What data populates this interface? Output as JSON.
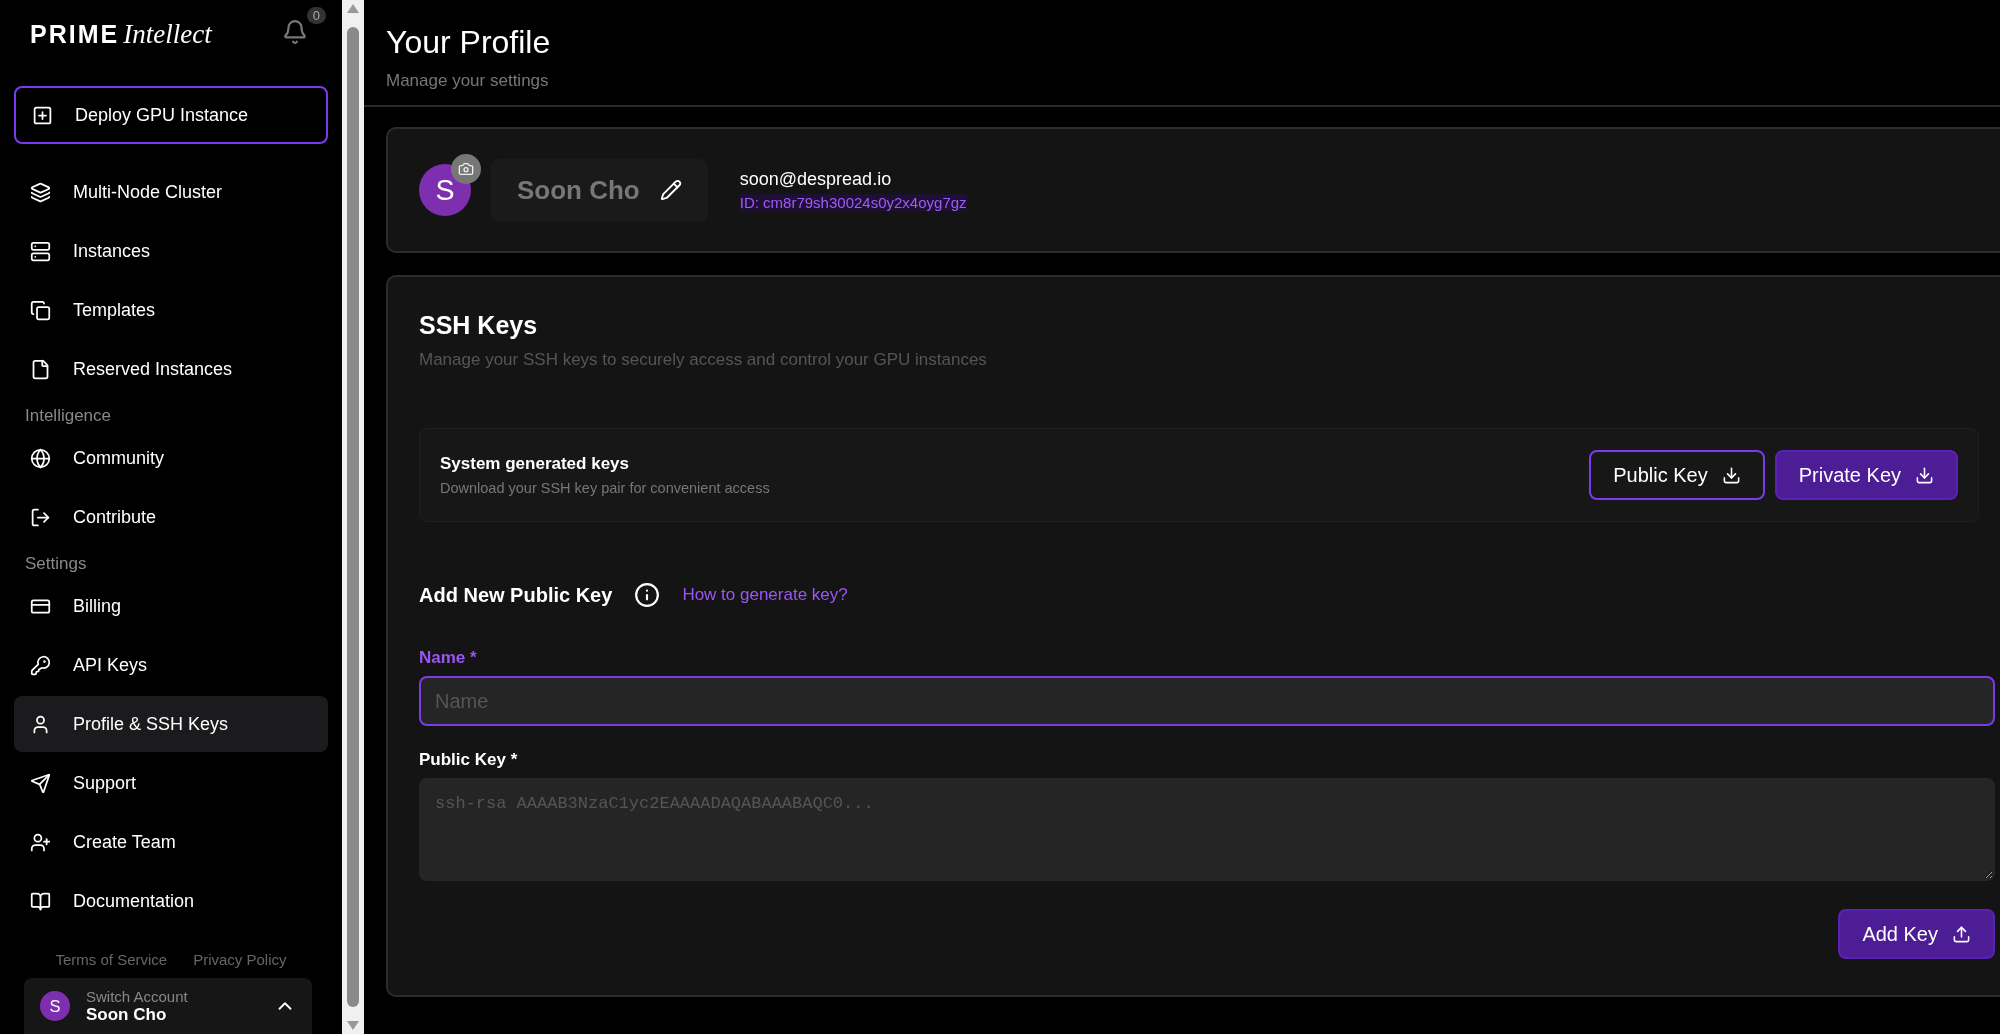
{
  "brand": {
    "wordmark": "PRIME",
    "script": "Intellect"
  },
  "notifications": {
    "count": "0"
  },
  "sidebar": {
    "items": [
      {
        "kind": "primary",
        "label": "Deploy GPU Instance",
        "selected": false
      },
      {
        "kind": "item",
        "label": "Multi-Node Cluster",
        "selected": false
      },
      {
        "kind": "item",
        "label": "Instances",
        "selected": false
      },
      {
        "kind": "item",
        "label": "Templates",
        "selected": false
      },
      {
        "kind": "item",
        "label": "Reserved Instances",
        "selected": false
      },
      {
        "kind": "section",
        "label": "Intelligence"
      },
      {
        "kind": "item",
        "label": "Community",
        "selected": false
      },
      {
        "kind": "item",
        "label": "Contribute",
        "selected": false
      },
      {
        "kind": "section",
        "label": "Settings"
      },
      {
        "kind": "item",
        "label": "Billing",
        "selected": false
      },
      {
        "kind": "item",
        "label": "API Keys",
        "selected": false
      },
      {
        "kind": "item",
        "label": "Profile & SSH Keys",
        "selected": true
      },
      {
        "kind": "item",
        "label": "Support",
        "selected": false
      },
      {
        "kind": "item",
        "label": "Create Team",
        "selected": false
      },
      {
        "kind": "item",
        "label": "Documentation",
        "selected": false
      }
    ],
    "footer_links": [
      "Terms of Service",
      "Privacy Policy"
    ],
    "account": {
      "initial": "S",
      "caption": "Switch Account",
      "name": "Soon Cho",
      "expanded": true
    }
  },
  "header": {
    "title": "Your Profile",
    "subtitle": "Manage your settings"
  },
  "profile": {
    "initial": "S",
    "name": "Soon Cho",
    "email": "soon@despread.io",
    "id": "ID: cm8r79sh30024s0y2x4oyg7gz"
  },
  "ssh": {
    "title": "SSH Keys",
    "description": "Manage your SSH keys to securely access and control your GPU instances",
    "system_keys": {
      "title": "System generated keys",
      "description": "Download your SSH key pair for convenient access",
      "buttons": [
        {
          "label": "Public Key",
          "kind": "outline"
        },
        {
          "label": "Private Key",
          "kind": "filled"
        }
      ]
    },
    "add_key": {
      "title": "Add New Public Key",
      "help_link": "How to generate key?",
      "name_field": {
        "label": "Name *",
        "placeholder": "Name",
        "focused": true
      },
      "key_field": {
        "label": "Public Key *",
        "placeholder": "ssh-rsa AAAAB3NzaC1yc2EAAAADAQABAAABAQC0...",
        "focused": false
      },
      "submit": "Add Key"
    }
  }
}
